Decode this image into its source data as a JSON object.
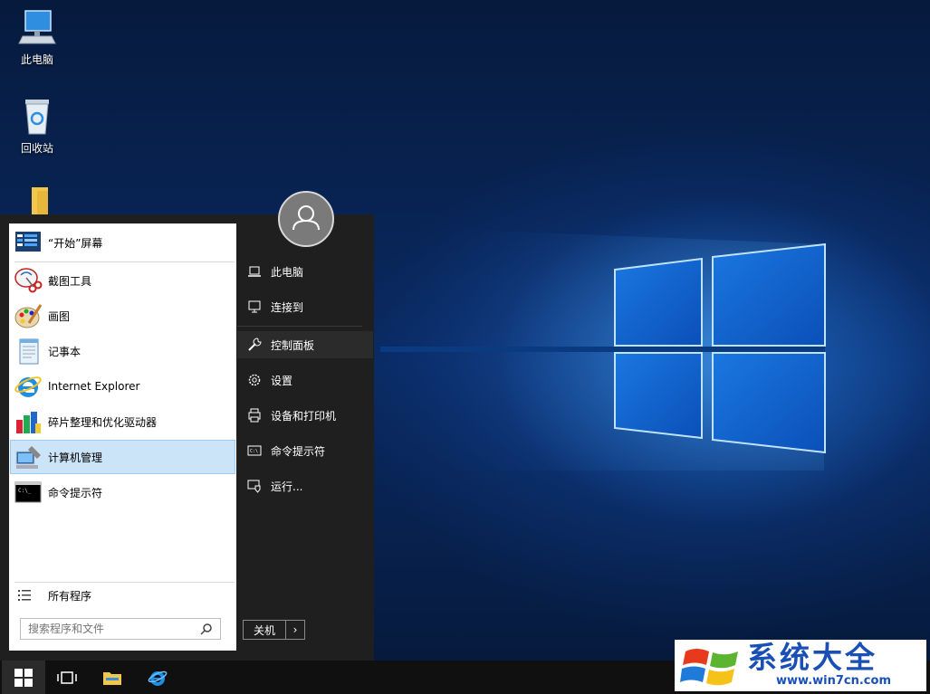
{
  "desktop": {
    "icons": [
      {
        "label": "此电脑"
      },
      {
        "label": "回收站"
      }
    ]
  },
  "start_menu": {
    "pinned_header": {
      "label": "“开始”屏幕"
    },
    "apps": [
      {
        "label": "截图工具",
        "icon": "snipping-tool-icon"
      },
      {
        "label": "画图",
        "icon": "paint-icon"
      },
      {
        "label": "记事本",
        "icon": "notepad-icon"
      },
      {
        "label": "Internet Explorer",
        "icon": "internet-explorer-icon"
      },
      {
        "label": "碎片整理和优化驱动器",
        "icon": "defrag-icon"
      },
      {
        "label": "计算机管理",
        "icon": "computer-management-icon",
        "selected": true
      },
      {
        "label": "命令提示符",
        "icon": "command-prompt-icon"
      }
    ],
    "all_programs": {
      "label": "所有程序"
    },
    "search": {
      "placeholder": "搜索程序和文件",
      "value": ""
    },
    "right_items": [
      {
        "label": "此电脑",
        "icon": "laptop-icon"
      },
      {
        "label": "连接到",
        "icon": "monitor-connect-icon"
      },
      {
        "label": "控制面板",
        "icon": "wrench-icon"
      },
      {
        "label": "设置",
        "icon": "gear-icon"
      },
      {
        "label": "设备和打印机",
        "icon": "printer-icon"
      },
      {
        "label": "命令提示符",
        "icon": "cmd-small-icon"
      },
      {
        "label": "运行...",
        "icon": "run-icon"
      }
    ],
    "shutdown": {
      "label": "关机",
      "arrow": "›"
    }
  },
  "watermark": {
    "title": "系统大全",
    "url": "www.win7cn.com"
  },
  "colors": {
    "accent": "#0078d7",
    "menu_bg": "#1f1f1f",
    "selected_bg": "#cce4f7"
  }
}
